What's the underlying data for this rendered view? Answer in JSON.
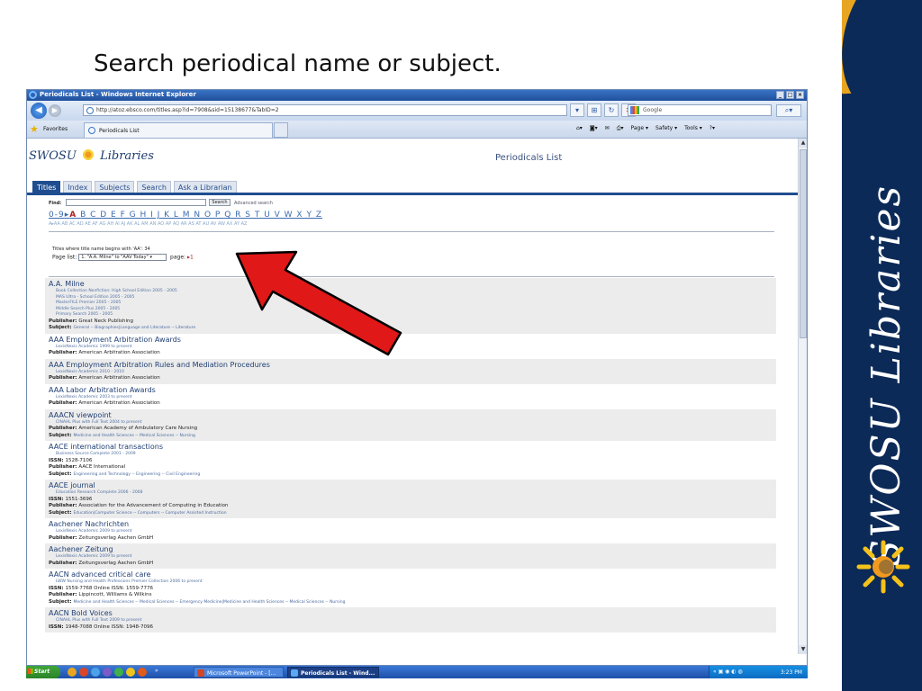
{
  "slide": {
    "title": "Search periodical name or subject.",
    "brand_text": "SWOSU Libraries",
    "colors": {
      "brand_bar": "#0c2a57",
      "swoosh": "#e8a521",
      "arrow": "#e01818"
    }
  },
  "browser": {
    "window_title": "Periodicals List - Windows Internet Explorer",
    "address": "http://atoz.ebsco.com/titles.asp?id=7908&sid=15138677&TabID=2",
    "search_placeholder": "Google",
    "favorites_label": "Favorites",
    "tab_label": "Periodicals List",
    "command_items": [
      "Page ▾",
      "Safety ▾",
      "Tools ▾"
    ]
  },
  "webpage": {
    "logo_left": "SWOSU",
    "logo_right": "Libraries",
    "page_title": "Periodicals List",
    "tabs": [
      {
        "label": "Titles",
        "active": true
      },
      {
        "label": "Index",
        "active": false
      },
      {
        "label": "Subjects",
        "active": false
      },
      {
        "label": "Search",
        "active": false
      },
      {
        "label": "Ask a Librarian",
        "active": false
      }
    ],
    "find_label": "Find:",
    "find_button": "Search",
    "advanced_search": "Advanced search",
    "letters_prefix": "0-9",
    "letters_active": "A",
    "letters_rest": "B C D E F G H I J K L M N O P Q R S T U V W X Y Z",
    "subletters": "A▸AA AB AC AD AE AF AG AH AI AJ AK AL AM AN AO AP AQ AR AS AT AU AV AW AX AY AZ",
    "titles_count": "Titles where title name begins with 'AA': 34",
    "page_list_label": "Page list:",
    "page_list_value": "1. \"A.A. Milne\" to \"AAV Today\"",
    "page_label": "page:",
    "page_value": "▸1",
    "records": [
      {
        "title": "A.A. Milne",
        "dbs": [
          "Book Collection Nonfiction: High School Edition  2005 - 2005",
          "MAS Ultra - School Edition  2005 - 2005",
          "MasterFILE Premier  2005 - 2005",
          "Middle Search Plus  2005 - 2005",
          "Primary Search  2005 - 2005"
        ],
        "issn": "",
        "publisher": "Great Neck Publishing",
        "subject": "General -- Biographies|Language and Literature -- Literature"
      },
      {
        "title": "AAA Employment Arbitration Awards",
        "dbs": [
          "LexisNexis Academic  1999 to present"
        ],
        "issn": "",
        "publisher": "American Arbitration Association",
        "subject": ""
      },
      {
        "title": "AAA Employment Arbitration Rules and Mediation Procedures",
        "dbs": [
          "LexisNexis Academic  2010 - 2010"
        ],
        "issn": "",
        "publisher": "American Arbitration Association",
        "subject": ""
      },
      {
        "title": "AAA Labor Arbitration Awards",
        "dbs": [
          "LexisNexis Academic  2003 to present"
        ],
        "issn": "",
        "publisher": "American Arbitration Association",
        "subject": ""
      },
      {
        "title": "AAACN viewpoint",
        "dbs": [
          "CINAHL Plus with Full Text  2004 to present"
        ],
        "issn": "",
        "publisher": "American Academy of Ambulatory Care Nursing",
        "subject": "Medicine and Health Sciences -- Medical Sciences -- Nursing"
      },
      {
        "title": "AACE international transactions",
        "dbs": [
          "Business Source Complete  2001 - 2009"
        ],
        "issn": "1528-7106",
        "publisher": "AACE International",
        "subject": "Engineering and Technology -- Engineering -- Civil Engineering"
      },
      {
        "title": "AACE journal",
        "dbs": [
          "Education Research Complete  2006 - 2008"
        ],
        "issn": "1551-3696",
        "publisher": "Association for the Advancement of Computing in Education",
        "subject": "Education|Computer Science -- Computers -- Computer Assisted Instruction"
      },
      {
        "title": "Aachener Nachrichten",
        "dbs": [
          "LexisNexis Academic  2009 to present"
        ],
        "issn": "",
        "publisher": "Zeitungsverlag Aachen GmbH",
        "subject": ""
      },
      {
        "title": "Aachener Zeitung",
        "dbs": [
          "LexisNexis Academic  2009 to present"
        ],
        "issn": "",
        "publisher": "Zeitungsverlag Aachen GmbH",
        "subject": ""
      },
      {
        "title": "AACN advanced critical care",
        "dbs": [
          "LWW Nursing and Health Professions Premier Collection  2006 to present"
        ],
        "issn": "1559-7768 Online ISSN: 1559-7776",
        "publisher": "Lippincott, Williams & Wilkins",
        "subject": "Medicine and Health Sciences -- Medical Sciences -- Emergency Medicine|Medicine and Health Sciences -- Medical Sciences -- Nursing"
      },
      {
        "title": "AACN Bold Voices",
        "dbs": [
          "CINAHL Plus with Full Text  2009 to present"
        ],
        "issn": "1948-7088 Online ISSN: 1948-7096",
        "publisher": "",
        "subject": ""
      }
    ],
    "labels": {
      "issn": "ISSN:",
      "publisher": "Publisher:",
      "subject": "Subject:"
    }
  },
  "taskbar": {
    "start": "Start",
    "task_ppt": "Microsoft PowerPoint - [...",
    "task_ie": "Periodicals List - Wind...",
    "clock": "3:23 PM",
    "chevron": "»"
  }
}
